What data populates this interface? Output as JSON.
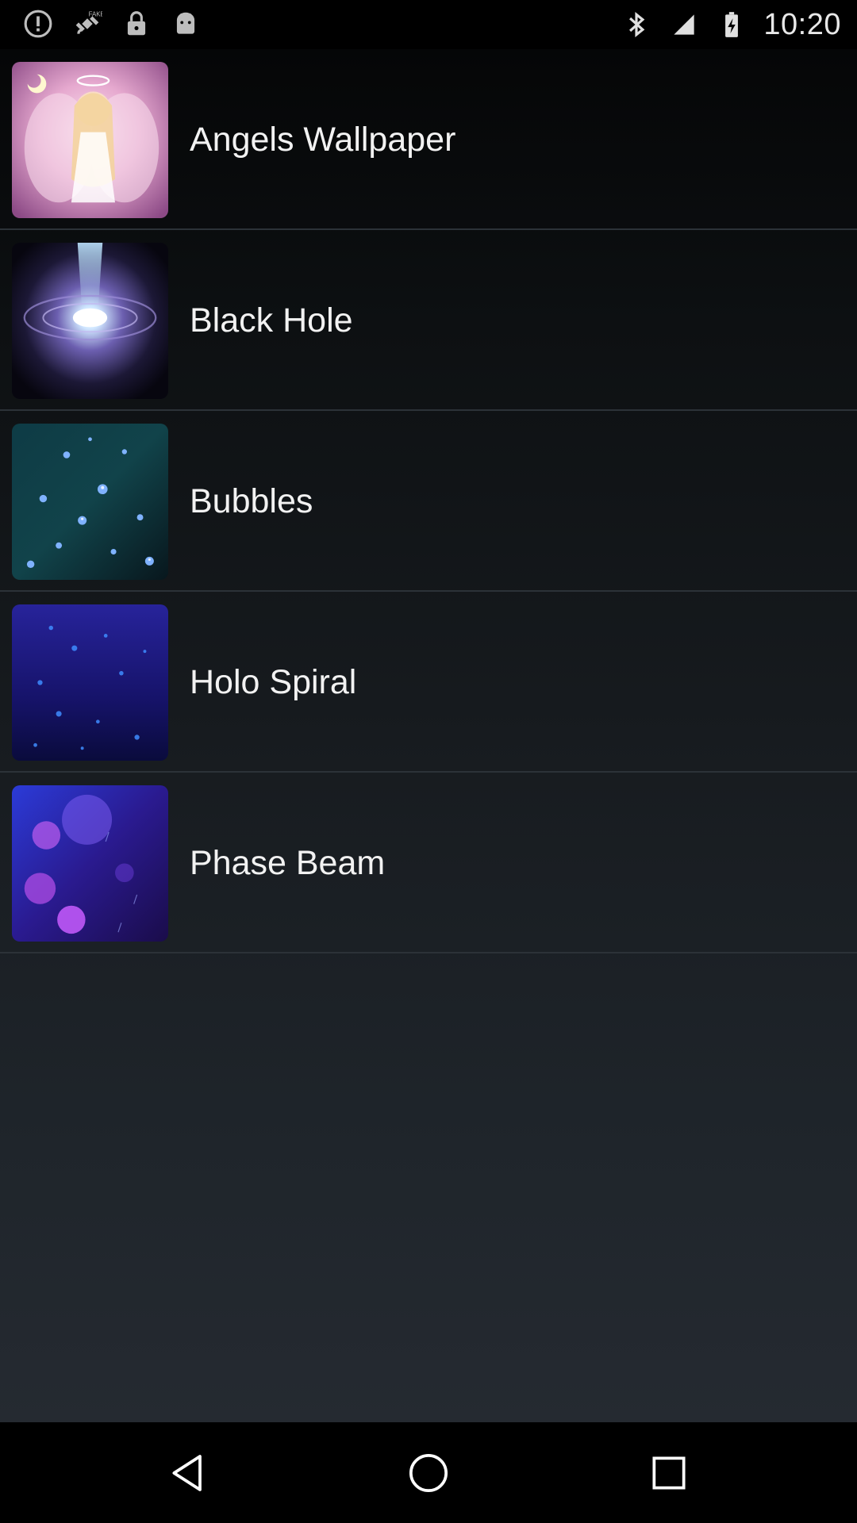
{
  "status_bar": {
    "time": "10:20",
    "left_icons": [
      "alert-circle-icon",
      "fake-gps-satellite-icon",
      "lock-icon",
      "android-icon"
    ],
    "right_icons": [
      "bluetooth-icon",
      "signal-icon",
      "battery-charging-icon"
    ]
  },
  "wallpapers": {
    "items": [
      {
        "label": "Angels Wallpaper",
        "thumbnail": "angel-thumbnail"
      },
      {
        "label": "Black Hole",
        "thumbnail": "black-hole-thumbnail"
      },
      {
        "label": "Bubbles",
        "thumbnail": "bubbles-thumbnail"
      },
      {
        "label": "Holo Spiral",
        "thumbnail": "holo-spiral-thumbnail"
      },
      {
        "label": "Phase Beam",
        "thumbnail": "phase-beam-thumbnail"
      }
    ]
  },
  "nav_bar": {
    "buttons": [
      "back-icon",
      "home-icon",
      "recents-icon"
    ]
  },
  "colors": {
    "text": "#f2f2f2",
    "divider": "#2c3238",
    "status_bar_bg": "#000000",
    "content_bg_top": "#050607",
    "content_bg_bottom": "#252a31"
  }
}
